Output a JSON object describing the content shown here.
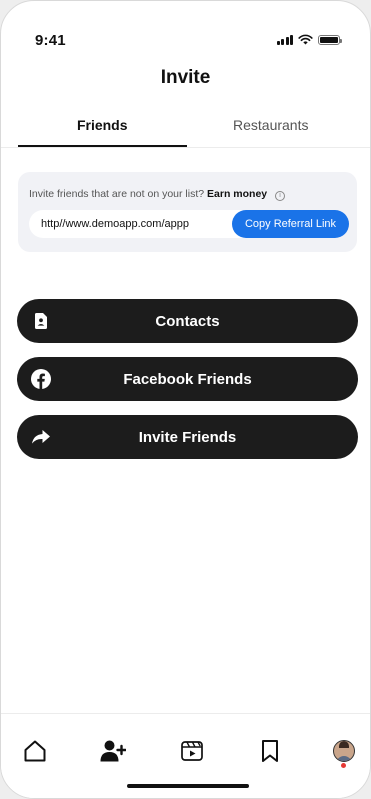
{
  "status_bar": {
    "time": "9:41"
  },
  "header": {
    "title": "Invite"
  },
  "tabs": [
    {
      "label": "Friends",
      "active": true
    },
    {
      "label": "Restaurants",
      "active": false
    }
  ],
  "referral": {
    "prompt": "Invite friends that are not on your list?",
    "highlight": "Earn money",
    "link_value": "http//www.demoapp.com/appp",
    "copy_label": "Copy Referral Link"
  },
  "actions": {
    "contacts_label": "Contacts",
    "facebook_label": "Facebook Friends",
    "invite_label": "Invite Friends"
  },
  "bottom_nav": {
    "items": [
      "home-icon",
      "add-user-icon",
      "video-icon",
      "bookmark-icon",
      "profile-avatar"
    ]
  },
  "colors": {
    "accent": "#1a73e8",
    "button_dark": "#1c1c1c",
    "card_bg": "#f1f2f6",
    "notification": "#e53935"
  }
}
